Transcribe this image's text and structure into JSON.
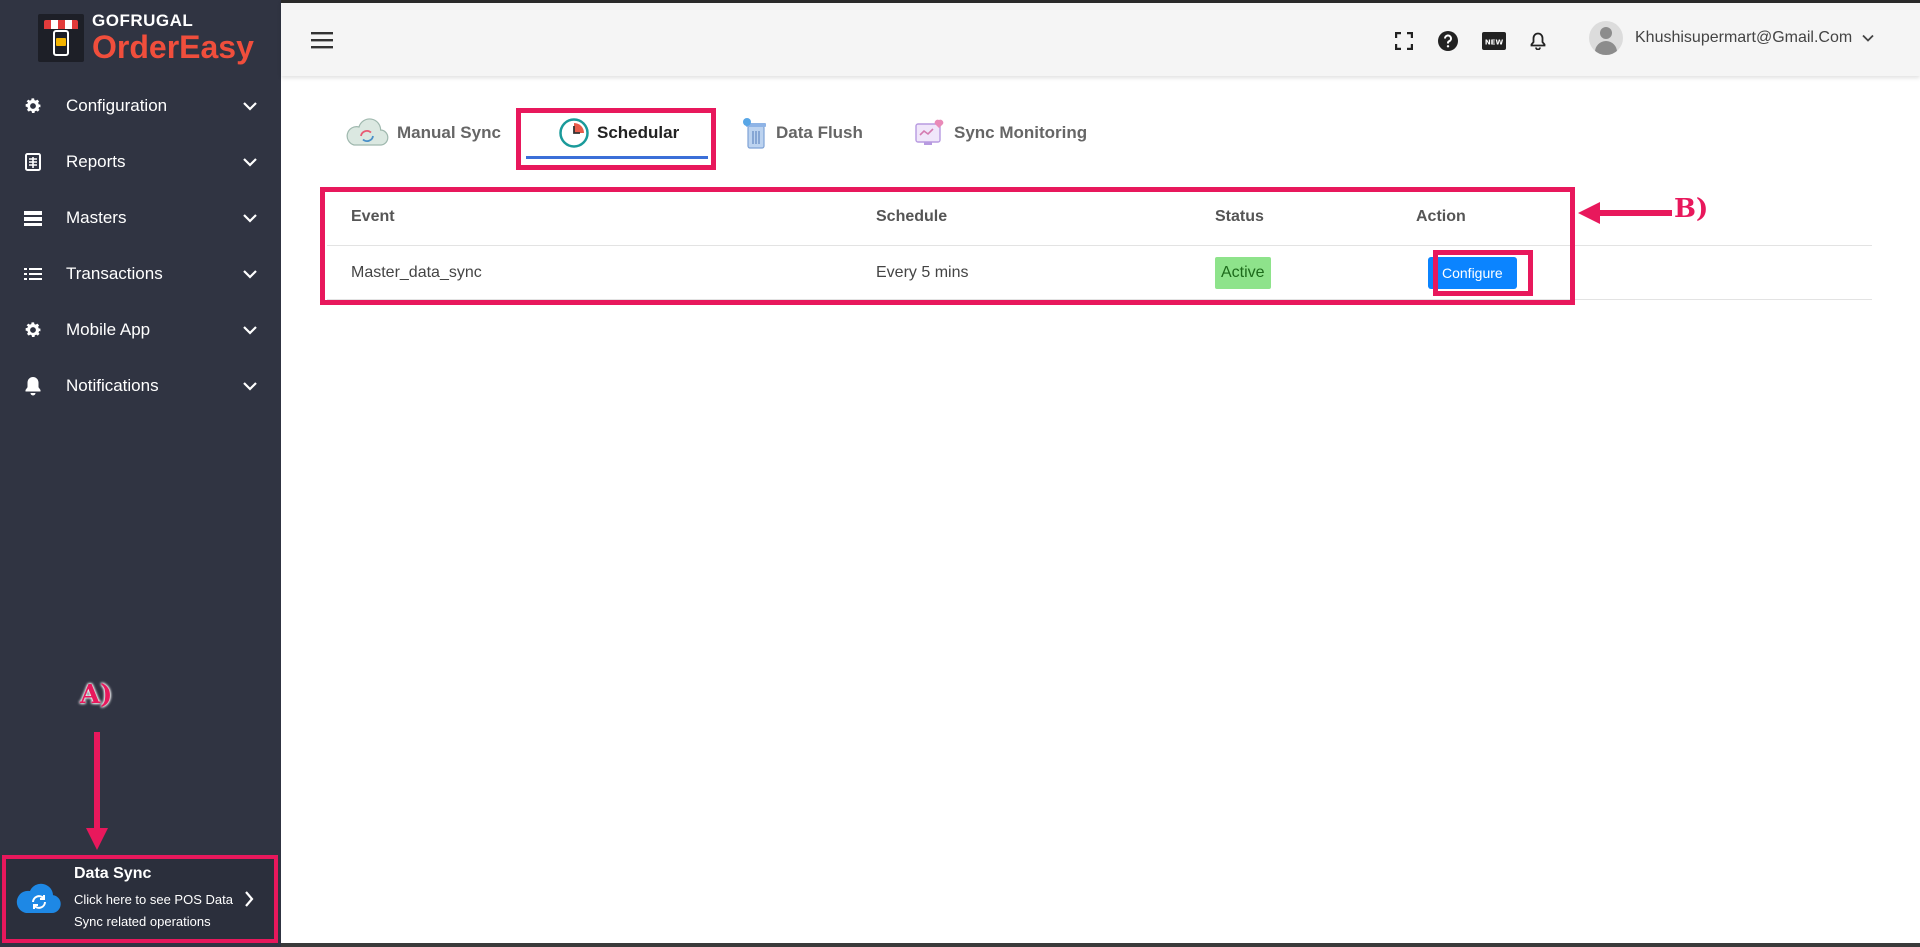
{
  "brand": {
    "top": "GOFRUGAL",
    "bottom": "OrderEasy"
  },
  "sidebar": {
    "items": [
      {
        "label": "Configuration",
        "icon": "gear-icon"
      },
      {
        "label": "Reports",
        "icon": "reports-icon"
      },
      {
        "label": "Masters",
        "icon": "masters-icon"
      },
      {
        "label": "Transactions",
        "icon": "list-icon"
      },
      {
        "label": "Mobile App",
        "icon": "gear-icon"
      },
      {
        "label": "Notifications",
        "icon": "bell-icon"
      }
    ],
    "data_sync": {
      "title": "Data Sync",
      "description": "Click here to see POS Data Sync related operations"
    }
  },
  "header": {
    "user_email": "Khushisupermart@Gmail.Com",
    "new_badge": "NEW"
  },
  "tabs": [
    {
      "label": "Manual Sync",
      "icon": "cloud-sync-icon",
      "active": false
    },
    {
      "label": "Schedular",
      "icon": "clock-icon",
      "active": true
    },
    {
      "label": "Data Flush",
      "icon": "trash-icon",
      "active": false
    },
    {
      "label": "Sync Monitoring",
      "icon": "monitor-icon",
      "active": false
    }
  ],
  "table": {
    "headers": {
      "event": "Event",
      "schedule": "Schedule",
      "status": "Status",
      "action": "Action"
    },
    "rows": [
      {
        "event": "Master_data_sync",
        "schedule": "Every 5 mins",
        "status": "Active",
        "action": "Configure"
      }
    ]
  },
  "annotations": {
    "a": "A)",
    "b": "B)"
  },
  "colors": {
    "sidebar_bg": "#303442",
    "accent": "#e8185c",
    "button_blue": "#0b84ff",
    "active_badge": "#8ee38b",
    "brand_red": "#f04e3c"
  }
}
